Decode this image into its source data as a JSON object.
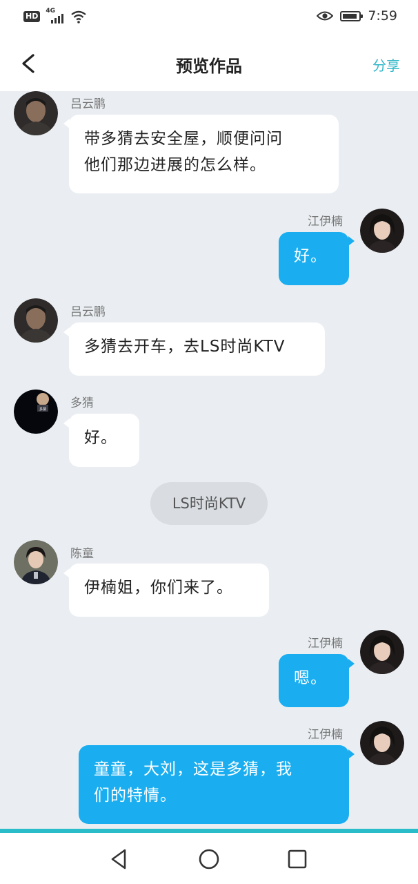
{
  "status_bar": {
    "hd": "HD",
    "network": "4G",
    "time": "7:59"
  },
  "header": {
    "title": "预览作品",
    "share_label": "分享"
  },
  "messages": [
    {
      "sender": "吕云鹏",
      "text_lines": [
        "带多猜去安全屋，顺便问问",
        "他们那边进展的怎么样。"
      ]
    },
    {
      "sender": "江伊楠",
      "text_lines": [
        "好。"
      ]
    },
    {
      "sender": "吕云鹏",
      "text_lines": [
        "多猜去开车，去LS时尚KTV"
      ]
    },
    {
      "sender": "多猜",
      "text_lines": [
        "好。"
      ],
      "avatar_caption": "多猜"
    },
    {
      "sender": "陈童",
      "text_lines": [
        "伊楠姐，你们来了。"
      ]
    },
    {
      "sender": "江伊楠",
      "text_lines": [
        "嗯。"
      ]
    },
    {
      "sender": "江伊楠",
      "text_lines": [
        "童童，大刘，这是多猜，我",
        "们的特情。"
      ]
    }
  ],
  "scene": {
    "label": "LS时尚KTV"
  },
  "colors": {
    "chat_bg": "#eaeef2",
    "bubble_self": "#1aaef0",
    "bubble_other": "#ffffff",
    "accent": "#2bbcc9",
    "share": "#34b7c8"
  },
  "icons": {
    "back": "chevron-left-icon",
    "nav_back": "triangle-back-icon",
    "nav_home": "circle-home-icon",
    "nav_recent": "square-recent-icon",
    "eye": "eye-icon",
    "wifi": "wifi-icon",
    "battery": "battery-icon"
  }
}
